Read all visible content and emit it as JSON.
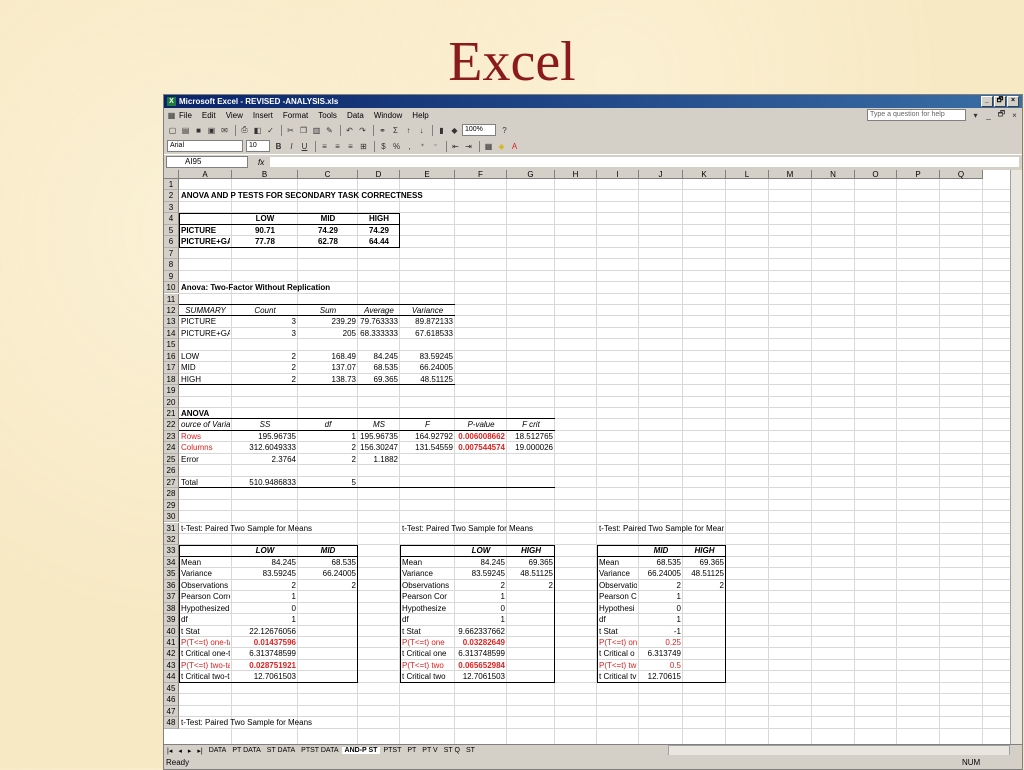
{
  "slide": {
    "title": "Excel"
  },
  "window": {
    "title": "Microsoft Excel - REVISED -ANALYSIS.xls",
    "icon": "excel-icon",
    "controls": [
      "_",
      "🗗",
      "×"
    ]
  },
  "menu": {
    "items": [
      "File",
      "Edit",
      "View",
      "Insert",
      "Format",
      "Tools",
      "Data",
      "Window",
      "Help"
    ],
    "help_placeholder": "Type a question for help",
    "doc_controls": [
      "▾",
      "_",
      "🗗",
      "×"
    ]
  },
  "toolbar": {
    "zoom": "100%",
    "font_name": "Arial",
    "font_size": "10"
  },
  "formula_bar": {
    "name_box": "AI95",
    "fx": "fx"
  },
  "columns": [
    "A",
    "B",
    "C",
    "D",
    "E",
    "F",
    "G",
    "H",
    "I",
    "J",
    "K",
    "L",
    "M",
    "N",
    "O",
    "P",
    "Q"
  ],
  "rows": [
    "1",
    "2",
    "3",
    "4",
    "5",
    "6",
    "7",
    "8",
    "9",
    "10",
    "11",
    "12",
    "13",
    "14",
    "15",
    "16",
    "17",
    "18",
    "19",
    "20",
    "21",
    "22",
    "23",
    "24",
    "25",
    "26",
    "27",
    "28",
    "29",
    "30",
    "31",
    "32",
    "33",
    "34",
    "35",
    "36",
    "37",
    "38",
    "39",
    "40",
    "41",
    "42",
    "43",
    "44",
    "45",
    "46",
    "47",
    "48"
  ],
  "cells": {
    "r2_title": "ANOVA AND P TESTS FOR SECONDARY TASK CORRECTNESS",
    "r4": [
      "LOW",
      "MID",
      "HIGH"
    ],
    "r5": [
      "PICTURE",
      "90.71",
      "74.29",
      "74.29"
    ],
    "r6": [
      "PICTURE+GAMI",
      "77.78",
      "62.78",
      "64.44"
    ],
    "r10": "Anova: Two-Factor Without Replication",
    "r12": [
      "SUMMARY",
      "Count",
      "Sum",
      "Average",
      "Variance"
    ],
    "r13": [
      "PICTURE",
      "3",
      "239.29",
      "79.763333",
      "89.872133"
    ],
    "r14": [
      "PICTURE+GAME",
      "3",
      "205",
      "68.333333",
      "67.618533"
    ],
    "r16": [
      "LOW",
      "2",
      "168.49",
      "84.245",
      "83.59245"
    ],
    "r17": [
      "MID",
      "2",
      "137.07",
      "68.535",
      "66.24005"
    ],
    "r18": [
      "HIGH",
      "2",
      "138.73",
      "69.365",
      "48.51125"
    ],
    "r21": "ANOVA",
    "r22": [
      "ource of Variatio",
      "SS",
      "df",
      "MS",
      "F",
      "P-value",
      "F crit"
    ],
    "r23": [
      "Rows",
      "195.96735",
      "1",
      "195.96735",
      "164.92792",
      "0.006008662",
      "18.512765"
    ],
    "r24": [
      "Columns",
      "312.6049333",
      "2",
      "156.30247",
      "131.54559",
      "0.007544574",
      "19.000026"
    ],
    "r25": [
      "Error",
      "2.3764",
      "2",
      "1.1882"
    ],
    "r27": [
      "Total",
      "510.9486833",
      "5"
    ],
    "r31": [
      "t-Test: Paired Two Sample for Means",
      "t-Test: Paired Two Sample for Means",
      "t-Test: Paired Two Sample for Means"
    ],
    "r48": "t-Test: Paired Two Sample for Means",
    "t1": {
      "headers": [
        "LOW",
        "MID"
      ],
      "rows": [
        [
          "Mean",
          "84.245",
          "68.535"
        ],
        [
          "Variance",
          "83.59245",
          "66.24005"
        ],
        [
          "Observations",
          "2",
          "2"
        ],
        [
          "Pearson Correlat",
          "1",
          ""
        ],
        [
          "Hypothesized Me",
          "0",
          ""
        ],
        [
          "df",
          "1",
          ""
        ],
        [
          "t Stat",
          "22.12676056",
          ""
        ],
        [
          "P(T<=t) one-tail",
          "0.01437596",
          ""
        ],
        [
          "t Critical one-tail",
          "6.313748599",
          ""
        ],
        [
          "P(T<=t) two-tail",
          "0.028751921",
          ""
        ],
        [
          "t Critical two-tail",
          "12.7061503",
          ""
        ]
      ]
    },
    "t2": {
      "headers": [
        "LOW",
        "HIGH"
      ],
      "rows": [
        [
          "Mean",
          "84.245",
          "69.365"
        ],
        [
          "Variance",
          "83.59245",
          "48.51125"
        ],
        [
          "Observations",
          "2",
          "2"
        ],
        [
          "Pearson Cor",
          "1",
          ""
        ],
        [
          "Hypothesize",
          "0",
          ""
        ],
        [
          "df",
          "1",
          ""
        ],
        [
          "t Stat",
          "9.662337662",
          ""
        ],
        [
          "P(T<=t) one",
          "0.03282649",
          ""
        ],
        [
          "t Critical one",
          "6.313748599",
          ""
        ],
        [
          "P(T<=t) two",
          "0.065652984",
          ""
        ],
        [
          "t Critical two",
          "12.7061503",
          ""
        ]
      ]
    },
    "t3": {
      "headers": [
        "MID",
        "HIGH"
      ],
      "rows": [
        [
          "Mean",
          "68.535",
          "69.365"
        ],
        [
          "Variance",
          "66.24005",
          "48.51125"
        ],
        [
          "Observatio",
          "2",
          "2"
        ],
        [
          "Pearson C",
          "1",
          ""
        ],
        [
          "Hypothesi",
          "0",
          ""
        ],
        [
          "df",
          "1",
          ""
        ],
        [
          "t Stat",
          "-1",
          ""
        ],
        [
          "P(T<=t) on",
          "0.25",
          ""
        ],
        [
          "t Critical o",
          "6.313749",
          ""
        ],
        [
          "P(T<=t) tw",
          "0.5",
          ""
        ],
        [
          "t Critical tv",
          "12.70615",
          ""
        ]
      ]
    }
  },
  "sheet_tabs": [
    "DATA",
    "PT DATA",
    "ST DATA",
    "PTST DATA",
    "AND-P ST",
    "PTST",
    "PT",
    "PT V",
    "ST Q",
    "ST"
  ],
  "active_tab": "AND-P ST",
  "status": {
    "left": "Ready",
    "right": "NUM"
  },
  "colors": {
    "title": "#8b1a1a",
    "red_value": "#e02020",
    "titlebar": "#0a246a"
  }
}
